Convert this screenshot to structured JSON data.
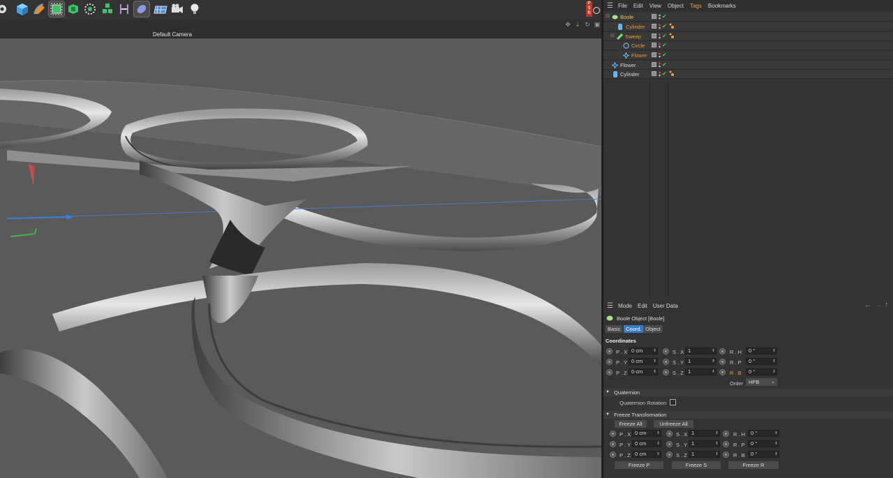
{
  "viewport": {
    "camera_label": "Default Camera"
  },
  "object_manager": {
    "menu": [
      "File",
      "Edit",
      "View",
      "Object",
      "Tags",
      "Bookmarks"
    ],
    "objects": [
      {
        "name": "Boole",
        "color": "#e8c860",
        "icon": "boole-icon"
      },
      {
        "name": "Cylinder",
        "color": "#e79a3a",
        "icon": "cylinder-icon"
      },
      {
        "name": "Sweep",
        "color": "#e79a3a",
        "icon": "sweep-icon"
      },
      {
        "name": "Circle",
        "color": "#e79a3a",
        "icon": "circle-spline-icon"
      },
      {
        "name": "Flower",
        "color": "#e79a3a",
        "icon": "flower-spline-icon"
      },
      {
        "name": "Flower",
        "color": "#d8d8d8",
        "icon": "flower-spline-icon"
      },
      {
        "name": "Cylinder",
        "color": "#d8d8d8",
        "icon": "cylinder-icon"
      }
    ]
  },
  "attributes": {
    "menu": [
      "Mode",
      "Edit",
      "User Data"
    ],
    "title": "Boole Object [Boole]",
    "tabs": [
      "Basic",
      "Coord.",
      "Object"
    ],
    "active_tab": "Coord.",
    "section_title": "Coordinates",
    "coords": {
      "px_label": "P . X",
      "px": "0 cm",
      "py_label": "P . Y",
      "py": "0 cm",
      "pz_label": "P . Z",
      "pz": "0 cm",
      "sx_label": "S . X",
      "sx": "1",
      "sy_label": "S . Y",
      "sy": "1",
      "sz_label": "S . Z",
      "sz": "1",
      "rh_label": "R . H",
      "rh": "0 °",
      "rp_label": "R . P",
      "rp": "0 °",
      "rb_label": "R . B",
      "rb": "0 °",
      "order_label": "Order",
      "order": "HPB"
    },
    "quaternion": {
      "title": "Quaternion",
      "rotation_label": "Quaternion Rotation"
    },
    "freeze": {
      "title": "Freeze Transformation",
      "freeze_all": "Freeze All",
      "unfreeze_all": "Unfreeze All",
      "px": "0 cm",
      "py": "0 cm",
      "pz": "0 cm",
      "sx": "1",
      "sy": "1",
      "sz": "1",
      "rh": "0 °",
      "rp": "0 °",
      "rb": "0 °",
      "freeze_p": "Freeze P",
      "freeze_s": "Freeze S",
      "freeze_r": "Freeze R"
    }
  },
  "toolbar": {
    "psr_label": "P S R"
  },
  "colors": {
    "accent": "#3a7bc8",
    "active_object": "#e79a3a",
    "boole": "#e8c860"
  }
}
